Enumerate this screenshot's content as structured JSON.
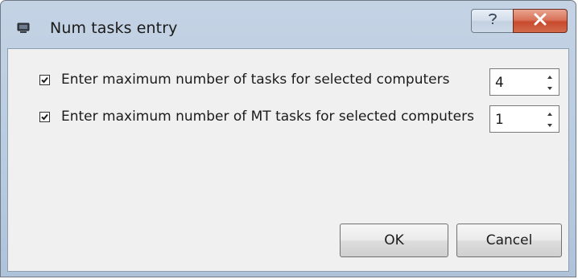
{
  "window": {
    "title": "Num tasks entry",
    "title_icon": "app-window-icon",
    "help_button": "?",
    "close_button": "X"
  },
  "rows": [
    {
      "checked": true,
      "label": "Enter maximum number of tasks for selected computers",
      "value": "4"
    },
    {
      "checked": true,
      "label": "Enter maximum number of MT tasks for selected computers",
      "value": "1"
    }
  ],
  "buttons": {
    "ok_label": "OK",
    "cancel_label": "Cancel"
  },
  "colors": {
    "frame": "#b8cbe0",
    "client_bg": "#f0f0f0",
    "close_red": "#c84a2e"
  }
}
